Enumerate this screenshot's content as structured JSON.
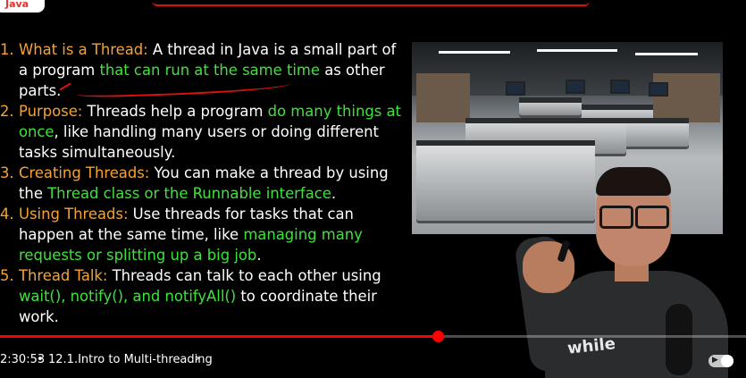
{
  "logo": {
    "text": "Java"
  },
  "slide": {
    "points": [
      {
        "num": "1.",
        "term": "What is a Thread:",
        "parts": [
          {
            "t": " A thread in Java is a small part of a program ",
            "h": false
          },
          {
            "t": "that can run at the same time",
            "h": true
          },
          {
            "t": " as other parts.",
            "h": false
          }
        ]
      },
      {
        "num": "2.",
        "term": "Purpose:",
        "parts": [
          {
            "t": " Threads help a program ",
            "h": false
          },
          {
            "t": "do many things at once",
            "h": true
          },
          {
            "t": ", like handling many users or doing different tasks simultaneously.",
            "h": false
          }
        ]
      },
      {
        "num": "3.",
        "term": "Creating Threads:",
        "parts": [
          {
            "t": " You can make a thread by using the ",
            "h": false
          },
          {
            "t": "Thread class or the Runnable interface",
            "h": true
          },
          {
            "t": ".",
            "h": false
          }
        ]
      },
      {
        "num": "4.",
        "term": "Using Threads:",
        "parts": [
          {
            "t": " Use threads for tasks that can happen at the same time, like ",
            "h": false
          },
          {
            "t": "managing many requests or splitting up a big job",
            "h": true
          },
          {
            "t": ".",
            "h": false
          }
        ]
      },
      {
        "num": "5.",
        "term": "Thread Talk:",
        "parts": [
          {
            "t": " Threads can talk to each other using ",
            "h": false
          },
          {
            "t": "wait(), notify(), and notifyAll()",
            "h": true
          },
          {
            "t": " to coordinate their work.",
            "h": false
          }
        ]
      }
    ]
  },
  "presenter": {
    "shirt_text": "while"
  },
  "player": {
    "progress": 0.587,
    "time": "2:30:53",
    "separator": "•",
    "chapter": "12.1.Intro to Multi-threading",
    "chevron_icon": "chevron-right-icon",
    "autoplay_icon": "autoplay-toggle-icon"
  },
  "colors": {
    "term": "#f7a234",
    "highlight": "#3fe23a",
    "progress": "#ff0000",
    "annotation": "#e01010"
  }
}
